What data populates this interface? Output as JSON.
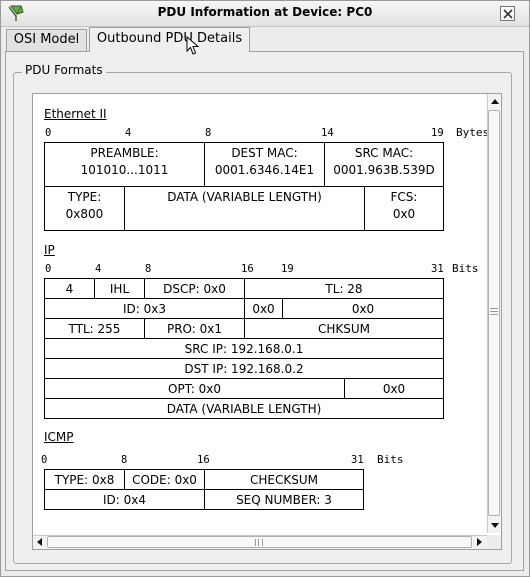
{
  "window": {
    "title": "PDU Information at Device: PC0",
    "app_icon": "network-pdu-icon",
    "close_icon": "close-icon"
  },
  "tabs": [
    {
      "label": "OSI Model",
      "selected": false
    },
    {
      "label": "Outbound PDU Details",
      "selected": true
    }
  ],
  "group_label": "PDU Formats",
  "ethernet": {
    "title": "Ethernet II",
    "bits": [
      "0",
      "4",
      "8",
      "14",
      "19"
    ],
    "unit": "Bytes",
    "preamble": {
      "label": "PREAMBLE:",
      "value": "101010...1011"
    },
    "dest_mac": {
      "label": "DEST MAC:",
      "value": "0001.6346.14E1"
    },
    "src_mac": {
      "label": "SRC MAC:",
      "value": "0001.963B.539D"
    },
    "type": {
      "label": "TYPE:",
      "value": "0x800"
    },
    "data": "DATA (VARIABLE LENGTH)",
    "fcs": {
      "label": "FCS:",
      "value": "0x0"
    }
  },
  "ip": {
    "title": "IP",
    "bits": [
      "0",
      "4",
      "8",
      "16",
      "19",
      "31"
    ],
    "unit": "Bits",
    "version": "4",
    "ihl": "IHL",
    "dscp": "DSCP: 0x0",
    "tl": "TL: 28",
    "id": "ID: 0x3",
    "flags": "0x0",
    "frag_offset": "0x0",
    "ttl": "TTL: 255",
    "pro": "PRO: 0x1",
    "chksum": "CHKSUM",
    "src_ip": "SRC IP: 192.168.0.1",
    "dst_ip": "DST IP: 192.168.0.2",
    "opt": "OPT: 0x0",
    "padding": "0x0",
    "data": "DATA (VARIABLE LENGTH)"
  },
  "icmp": {
    "title": "ICMP",
    "bits": [
      "0",
      "8",
      "16",
      "31"
    ],
    "unit": "Bits",
    "type": "TYPE: 0x8",
    "code": "CODE: 0x0",
    "checksum": "CHECKSUM",
    "id": "ID: 0x4",
    "seq": "SEQ NUMBER: 3"
  }
}
